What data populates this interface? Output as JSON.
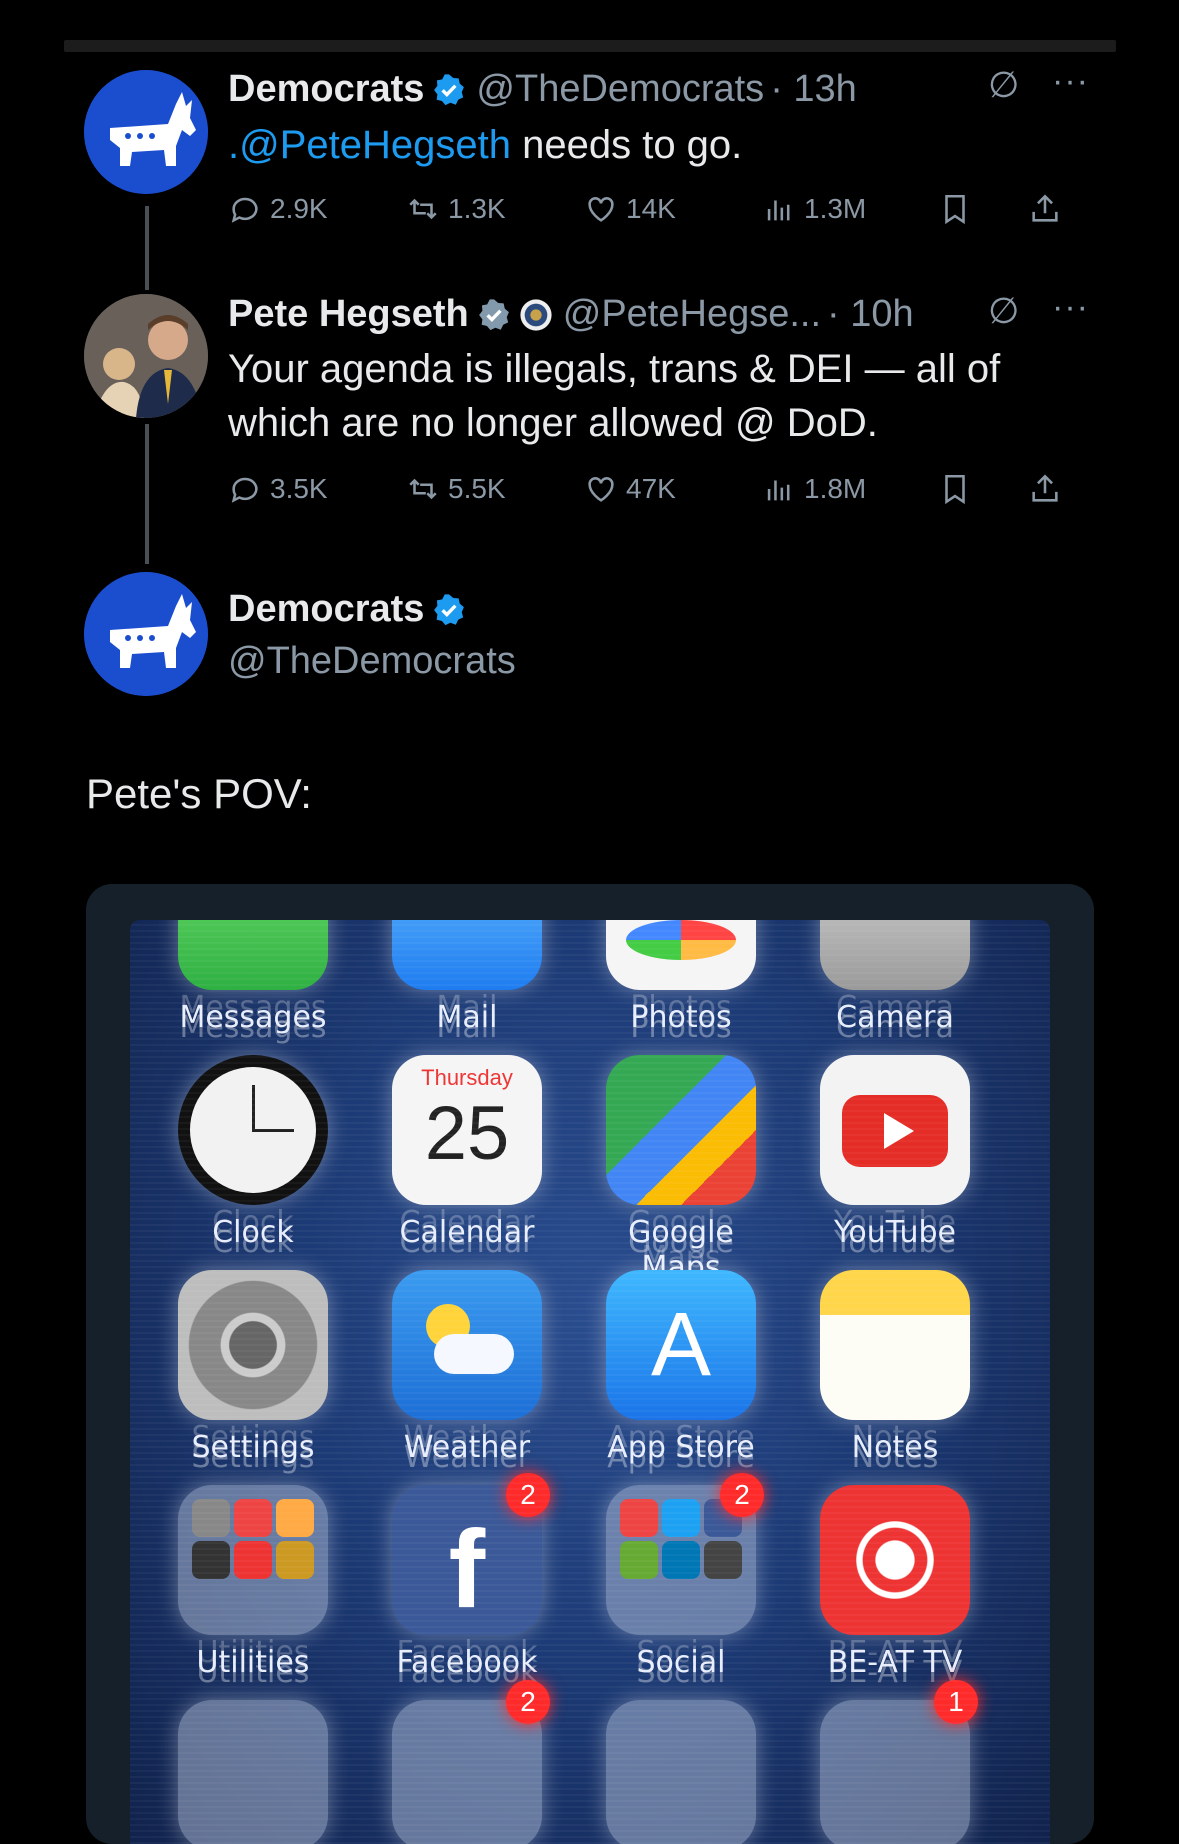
{
  "tweet1": {
    "name": "Democrats",
    "handle": "@TheDemocrats",
    "time": "· 13h",
    "mention": ".@PeteHegseth",
    "text": " needs to go.",
    "replies": "2.9K",
    "reposts": "1.3K",
    "likes": "14K",
    "views": "1.3M"
  },
  "tweet2": {
    "name": "Pete Hegseth",
    "handle": "@PeteHegse...",
    "time": "· 10h",
    "text": "Your agenda is illegals, trans & DEI — all of which are no longer allowed @ DoD.",
    "replies": "3.5K",
    "reposts": "5.5K",
    "likes": "47K",
    "views": "1.8M"
  },
  "tweet3": {
    "name": "Democrats",
    "handle": "@TheDemocrats",
    "text": "Pete's POV:"
  },
  "media": {
    "calendar_day": "Thursday",
    "calendar_date": "25",
    "apps": [
      "Messages",
      "Mail",
      "Photos",
      "Camera",
      "Clock",
      "Calendar",
      "Google Maps",
      "YouTube",
      "Settings",
      "Weather",
      "App Store",
      "Notes",
      "Utilities",
      "Facebook",
      "Social",
      "BE-AT TV"
    ],
    "badges": [
      "2",
      "2",
      "2",
      "1"
    ]
  },
  "colors": {
    "accent": "#1d9bf0",
    "dem_blue": "#1a4ecf",
    "muted": "#8b98a5"
  }
}
